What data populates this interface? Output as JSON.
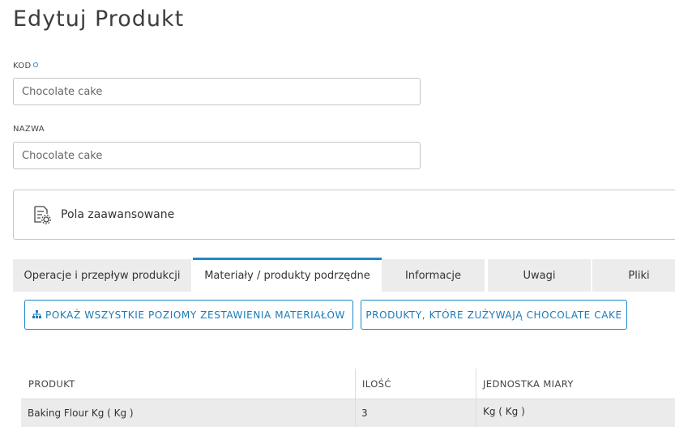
{
  "page": {
    "title": "Edytuj Produkt"
  },
  "form": {
    "code": {
      "label": "KOD",
      "value": "Chocolate cake"
    },
    "name": {
      "label": "NAZWA",
      "value": "Chocolate cake"
    }
  },
  "advanced": {
    "label": "Pola zaawansowane",
    "icon": "document-settings-icon"
  },
  "tabs": [
    {
      "label": "Operacje i przepływ produkcji",
      "active": false
    },
    {
      "label": "Materiały / produkty podrzędne",
      "active": true
    },
    {
      "label": "Informacje",
      "active": false
    },
    {
      "label": "Uwagi",
      "active": false
    },
    {
      "label": "Pliki",
      "active": false
    }
  ],
  "actions": {
    "show_all_levels": "POKAŻ WSZYSTKIE POZIOMY ZESTAWIENIA MATERIAŁÓW",
    "products_using": "PRODUKTY, KTÓRE ZUŻYWAJĄ CHOCOLATE CAKE"
  },
  "table": {
    "headers": [
      "PRODUKT",
      "ILOŚĆ",
      "JEDNOSTKA MIARY"
    ],
    "rows": [
      [
        "Baking Flour Kg ( Kg )",
        "3",
        "Kg ( Kg )"
      ]
    ]
  },
  "colors": {
    "accent": "#1e88c9",
    "tab_bg": "#ececec",
    "row_bg": "#ebebeb"
  }
}
